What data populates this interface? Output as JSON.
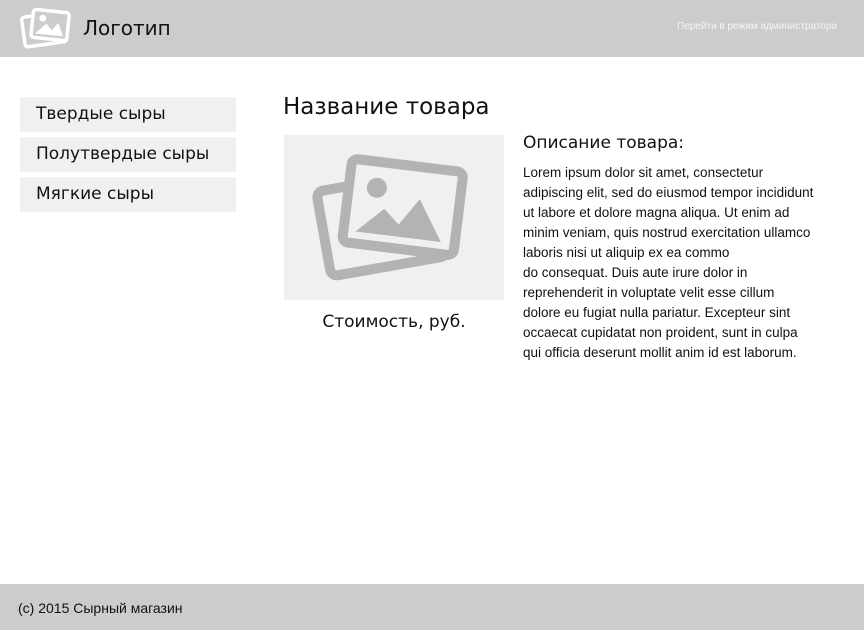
{
  "header": {
    "logo_text": "Логотип",
    "logo_icon": "image-icon",
    "admin_link": "Перейти в режим администратора"
  },
  "sidebar": {
    "items": [
      {
        "label": "Твердые сыры"
      },
      {
        "label": "Полутвердые сыры"
      },
      {
        "label": "Мягкие сыры"
      }
    ]
  },
  "product": {
    "title": "Название товара",
    "image_icon": "image-placeholder-icon",
    "price_label": "Стоимость, руб.",
    "description_heading": "Описание товара:",
    "description": "Lorem ipsum dolor sit amet, consectetur\nadipiscing elit, sed do eiusmod tempor incididunt\nut labore et dolore magna aliqua. Ut enim ad\nminim veniam, quis nostrud exercitation ullamco\nlaboris nisi ut aliquip ex ea commo\ndo consequat. Duis aute irure dolor in\nreprehenderit in voluptate velit esse cillum\ndolore eu fugiat nulla pariatur. Excepteur sint\noccaecat cupidatat non proident, sunt in culpa\nqui officia deserunt mollit anim id est laborum."
  },
  "footer": {
    "copyright": "(c) 2015 Сырный магазин"
  },
  "colors": {
    "header_bg": "#cccccc",
    "footer_bg": "#cccccc",
    "panel_bg": "#f0f0f0",
    "icon_gray": "#a6a6a6"
  }
}
